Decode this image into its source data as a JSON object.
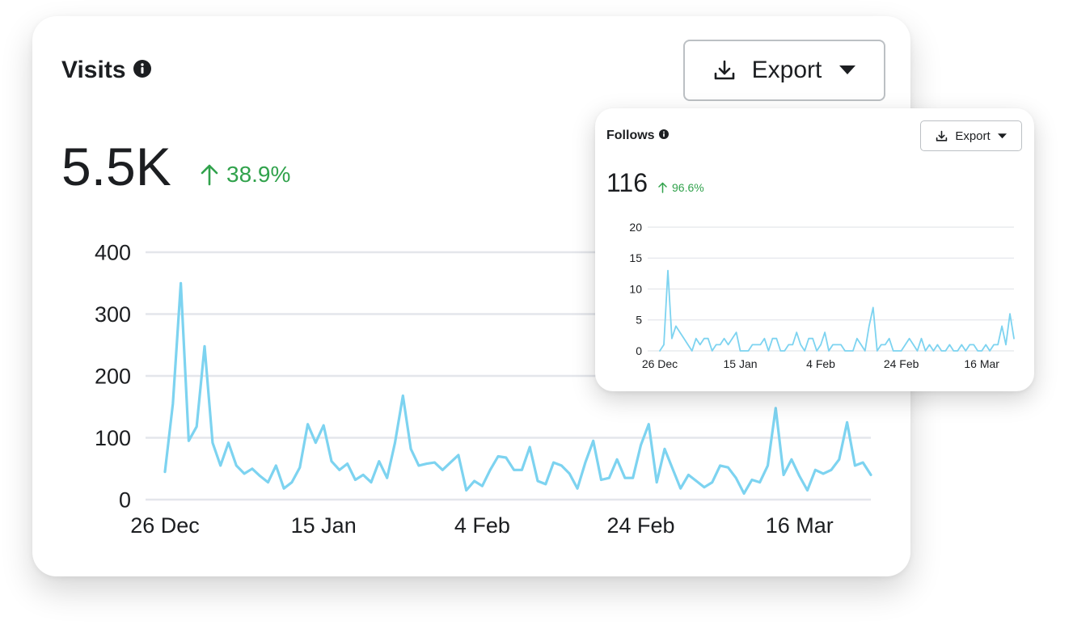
{
  "visits": {
    "title": "Visits",
    "export_label": "Export",
    "total": "5.5K",
    "delta": "38.9%",
    "chart_data": {
      "type": "line",
      "title": "",
      "xlabel": "",
      "ylabel": "",
      "ylim": [
        0,
        400
      ],
      "yticks": [
        0,
        100,
        200,
        300,
        400
      ],
      "x_tick_labels": [
        "26 Dec",
        "15 Jan",
        "4 Feb",
        "24 Feb",
        "16 Mar"
      ],
      "x_tick_index": [
        0,
        20,
        40,
        60,
        80
      ],
      "grid": true,
      "color": "#7dd3f0",
      "values": [
        45,
        155,
        350,
        95,
        118,
        248,
        92,
        55,
        92,
        55,
        42,
        50,
        38,
        28,
        55,
        18,
        28,
        52,
        122,
        92,
        120,
        62,
        48,
        58,
        32,
        40,
        28,
        62,
        35,
        92,
        168,
        82,
        55,
        58,
        60,
        48,
        60,
        72,
        15,
        30,
        22,
        48,
        70,
        68,
        48,
        48,
        85,
        30,
        25,
        60,
        55,
        42,
        18,
        60,
        95,
        32,
        35,
        65,
        35,
        35,
        88,
        122,
        28,
        82,
        50,
        18,
        40,
        30,
        20,
        28,
        55,
        52,
        35,
        10,
        32,
        28,
        55,
        148,
        40,
        65,
        38,
        15,
        48,
        42,
        48,
        65,
        125,
        55,
        60,
        40
      ]
    },
    "download_icon": "download-icon",
    "caret_icon": "caret-down-icon",
    "info_icon": "info-icon",
    "arrow_icon": "arrow-up-icon"
  },
  "follows": {
    "title": "Follows",
    "export_label": "Export",
    "total": "116",
    "delta": "96.6%",
    "chart_data": {
      "type": "line",
      "title": "",
      "xlabel": "",
      "ylabel": "",
      "ylim": [
        0,
        20
      ],
      "yticks": [
        0,
        5,
        10,
        15,
        20
      ],
      "x_tick_labels": [
        "26 Dec",
        "15 Jan",
        "4 Feb",
        "24 Feb",
        "16 Mar"
      ],
      "x_tick_index": [
        0,
        20,
        40,
        60,
        80
      ],
      "grid": true,
      "color": "#7dd3f0",
      "values": [
        0,
        1,
        13,
        2,
        4,
        3,
        2,
        1,
        0,
        2,
        1,
        2,
        2,
        0,
        1,
        1,
        2,
        1,
        2,
        3,
        0,
        0,
        0,
        1,
        1,
        1,
        2,
        0,
        2,
        2,
        0,
        0,
        1,
        1,
        3,
        1,
        0,
        2,
        2,
        0,
        1,
        3,
        0,
        1,
        1,
        1,
        0,
        0,
        0,
        2,
        1,
        0,
        4,
        7,
        0,
        1,
        1,
        2,
        0,
        0,
        0,
        1,
        2,
        1,
        0,
        2,
        0,
        1,
        0,
        1,
        0,
        0,
        1,
        0,
        0,
        1,
        0,
        1,
        1,
        0,
        0,
        1,
        0,
        1,
        1,
        4,
        1,
        6,
        2
      ]
    }
  },
  "colors": {
    "accent_line": "#7dd3f0",
    "positive": "#31a24c",
    "grid": "#e4e6eb",
    "text": "#1c1e21"
  }
}
